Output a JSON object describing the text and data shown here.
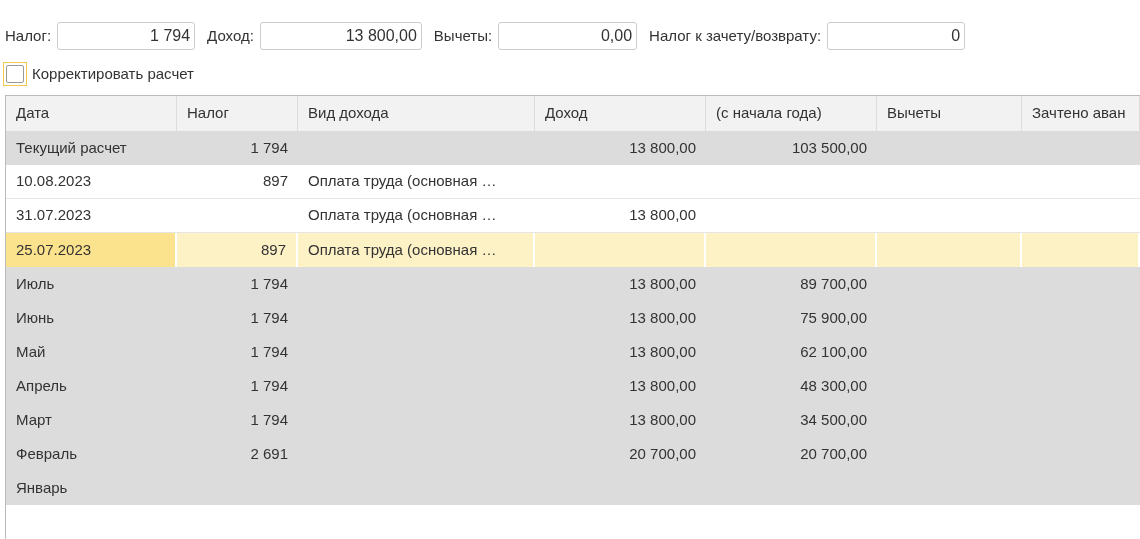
{
  "summary_fields": [
    {
      "label": "Налог:",
      "value": "1 794"
    },
    {
      "label": "Доход:",
      "value": "13 800,00"
    },
    {
      "label": "Вычеты:",
      "value": "0,00"
    },
    {
      "label": "Налог к зачету/возврату:",
      "value": "0"
    }
  ],
  "correct_checkbox": {
    "label": "Корректировать расчет",
    "checked": false,
    "focused": true
  },
  "table": {
    "columns": [
      "Дата",
      "Налог",
      "Вид дохода",
      "Доход",
      "(с начала года)",
      "Вычеты",
      "Зачтено аван"
    ],
    "rows": [
      {
        "kind": "group",
        "selected": false,
        "date": "Текущий расчет",
        "tax": "1 794",
        "income": "13 800,00",
        "ytd": "103 500,00"
      },
      {
        "kind": "detail",
        "selected": false,
        "date": "10.08.2023",
        "tax": "897",
        "income_type": "Оплата труда (основная …"
      },
      {
        "kind": "detail",
        "selected": false,
        "date": "31.07.2023",
        "income_type": "Оплата труда (основная …",
        "income": "13 800,00"
      },
      {
        "kind": "detail",
        "selected": true,
        "date": "25.07.2023",
        "tax": "897",
        "income_type": "Оплата труда (основная …"
      },
      {
        "kind": "group",
        "selected": false,
        "date": "Июль",
        "tax": "1 794",
        "income": "13 800,00",
        "ytd": "89 700,00"
      },
      {
        "kind": "group",
        "selected": false,
        "date": "Июнь",
        "tax": "1 794",
        "income": "13 800,00",
        "ytd": "75 900,00"
      },
      {
        "kind": "group",
        "selected": false,
        "date": "Май",
        "tax": "1 794",
        "income": "13 800,00",
        "ytd": "62 100,00"
      },
      {
        "kind": "group",
        "selected": false,
        "date": "Апрель",
        "tax": "1 794",
        "income": "13 800,00",
        "ytd": "48 300,00"
      },
      {
        "kind": "group",
        "selected": false,
        "date": "Март",
        "tax": "1 794",
        "income": "13 800,00",
        "ytd": "34 500,00"
      },
      {
        "kind": "group",
        "selected": false,
        "date": "Февраль",
        "tax": "2 691",
        "income": "20 700,00",
        "ytd": "20 700,00"
      },
      {
        "kind": "group",
        "selected": false,
        "date": "Январь"
      }
    ]
  }
}
